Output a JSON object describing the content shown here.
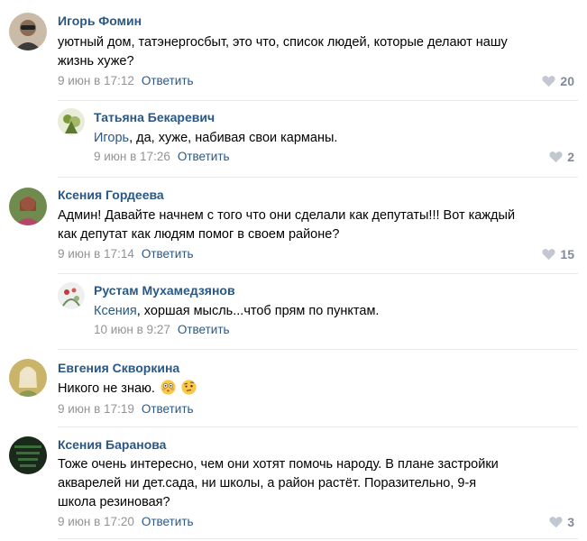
{
  "comments": [
    {
      "name": "Игорь Фомин",
      "text_lines": [
        "уютный дом, татэнергосбыт, это что, список людей, которые делают нашу",
        "жизнь хуже?"
      ],
      "date": "9 июн в 17:12",
      "reply": "Ответить",
      "likes": "20"
    },
    {
      "name": "Татьяна Бекаревич",
      "address": "Игорь",
      "text": ", да, хуже, набивая свои карманы.",
      "date": "9 июн в 17:26",
      "reply": "Ответить",
      "likes": "2"
    },
    {
      "name": "Ксения Гордеева",
      "text_lines": [
        "Админ! Давайте начнем с того что они сделали как депутаты!!! Вот каждый",
        "как депутат как людям помог в своем районе?"
      ],
      "date": "9 июн в 17:14",
      "reply": "Ответить",
      "likes": "15"
    },
    {
      "name": "Рустам Мухамедзянов",
      "address": "Ксения",
      "text": ", хоршая мысль...чтоб прям по пунктам.",
      "date": "10 июн в 9:27",
      "reply": "Ответить"
    },
    {
      "name": "Евгения Скворкина",
      "text": "Никого не знаю.",
      "emojis": [
        "flushed-face-icon",
        "face-with-raised-eyebrow-icon"
      ],
      "date": "9 июн в 17:19",
      "reply": "Ответить"
    },
    {
      "name": "Ксения Баранова",
      "text_lines": [
        "Тоже очень интересно, чем они хотят помочь народу. В плане застройки",
        "акварелей ни дет.сада, ни школы, а район растёт. Поразительно, 9-я",
        "школа резиновая?"
      ],
      "date": "9 июн в 17:20",
      "reply": "Ответить",
      "likes": "3"
    }
  ],
  "icons": {
    "like": "heart-icon"
  },
  "colors": {
    "link": "#2a5885",
    "meta": "#939393",
    "likes": "#828a99",
    "separator": "#e7e8ec"
  }
}
